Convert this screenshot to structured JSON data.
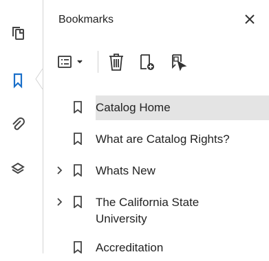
{
  "panel": {
    "title": "Bookmarks"
  },
  "rail": {
    "items": [
      {
        "name": "pages-icon"
      },
      {
        "name": "bookmark-icon",
        "active": true
      },
      {
        "name": "attachment-icon"
      },
      {
        "name": "layers-icon"
      }
    ]
  },
  "toolbar": {
    "icons": [
      "options-menu-icon",
      "delete-icon",
      "new-bookmark-icon",
      "bookmark-from-selection-icon"
    ]
  },
  "bookmarks": [
    {
      "label": "Catalog Home",
      "selected": true,
      "expandable": false
    },
    {
      "label": "What are Catalog Rights?",
      "selected": false,
      "expandable": false
    },
    {
      "label": "Whats New",
      "selected": false,
      "expandable": true
    },
    {
      "label": "The California State University",
      "selected": false,
      "expandable": true
    },
    {
      "label": "Accreditation",
      "selected": false,
      "expandable": false
    }
  ],
  "colors": {
    "accent": "#1a6fc9",
    "icon": "#555555",
    "selected_bg": "#e4e4e4"
  }
}
